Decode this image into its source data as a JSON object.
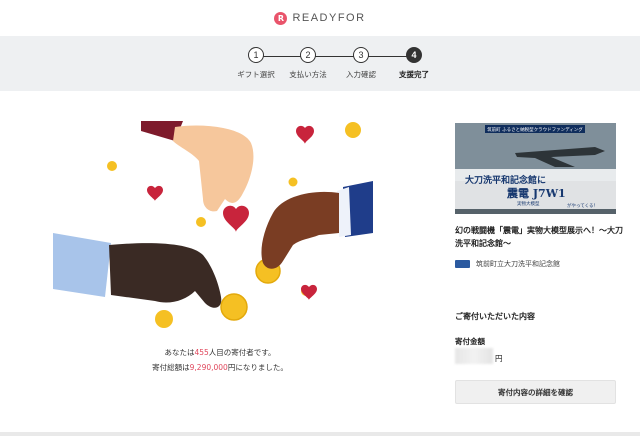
{
  "brand": {
    "logo_text": "READYFOR"
  },
  "stepper": {
    "steps": [
      {
        "number": "1",
        "label": "ギフト選択",
        "active": false
      },
      {
        "number": "2",
        "label": "支払い方法",
        "active": false
      },
      {
        "number": "3",
        "label": "入力確認",
        "active": false
      },
      {
        "number": "4",
        "label": "支援完了",
        "active": true
      }
    ]
  },
  "completion": {
    "line1_prefix": "あなたは",
    "supporter_count": "455",
    "line1_suffix": "人目の寄付者です。",
    "line2_prefix": "寄付総額は",
    "total_amount": "9,290,000",
    "line2_suffix": "円になりました。"
  },
  "project": {
    "image_banner": "筑前町 ふるさと納税型クラウドファンディング",
    "image_line1": "大刀洗平和記念館に",
    "image_line2": "震電 J7W1",
    "image_line3": "実物大模型",
    "image_line4": "がやってくる！",
    "title": "幻の戦闘機「震電」実物大模型展示へ！〜大刀洗平和記念館〜",
    "organization": "筑前町立大刀洗平和記念館"
  },
  "donation": {
    "heading": "ご寄付いただいた内容",
    "amount_label": "寄付金額",
    "amount_unit": "円",
    "detail_button": "寄付内容の詳細を確認"
  },
  "colors": {
    "accent": "#e0475c",
    "band": "#eef0f2",
    "heart": "#c8243c",
    "coin": "#f5c023"
  }
}
